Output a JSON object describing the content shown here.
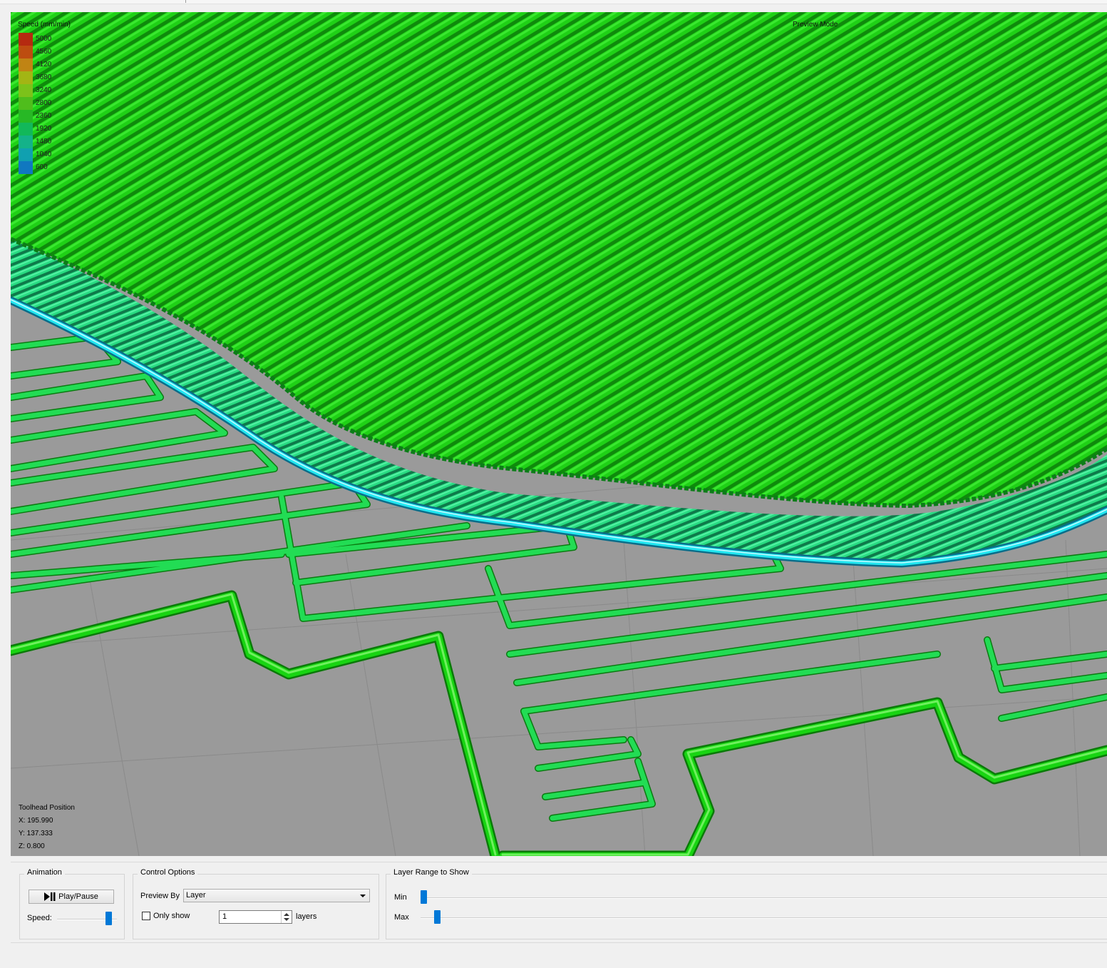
{
  "viewport": {
    "legend_title": "Speed (mm/min)",
    "preview_mode_label": "Preview Mode",
    "legend": [
      {
        "label": "5000",
        "color": "#b52a10"
      },
      {
        "label": "4560",
        "color": "#bd4d10"
      },
      {
        "label": "4120",
        "color": "#c08414"
      },
      {
        "label": "3680",
        "color": "#a3b514"
      },
      {
        "label": "3240",
        "color": "#7cc21a"
      },
      {
        "label": "2800",
        "color": "#4fbd1c"
      },
      {
        "label": "2360",
        "color": "#27b825"
      },
      {
        "label": "1920",
        "color": "#12b85a"
      },
      {
        "label": "1480",
        "color": "#14b289"
      },
      {
        "label": "1040",
        "color": "#10a0b0"
      },
      {
        "label": "600",
        "color": "#1078c0"
      }
    ],
    "toolhead": {
      "title": "Toolhead Position",
      "x": "X: 195.990",
      "y": "Y: 137.333",
      "z": "Z: 0.800"
    },
    "colors": {
      "bed": "#9a9a9a",
      "infill": "#1fd116",
      "perimeter": "#26e07a",
      "outer_wall": "#22e6f0",
      "travel_path": "#18d412"
    }
  },
  "controls": {
    "animation": {
      "title": "Animation",
      "play_pause_label": "Play/Pause",
      "speed_label": "Speed:",
      "speed_value": 0.9
    },
    "control_options": {
      "title": "Control Options",
      "preview_by_label": "Preview By",
      "preview_by_value": "Layer",
      "only_show_label": "Only show",
      "only_show_checked": false,
      "layers_value": "1",
      "layers_label": "layers"
    },
    "layer_range": {
      "title": "Layer Range to Show",
      "min_label": "Min",
      "max_label": "Max",
      "min_value": 0.0,
      "max_value": 0.02
    }
  }
}
